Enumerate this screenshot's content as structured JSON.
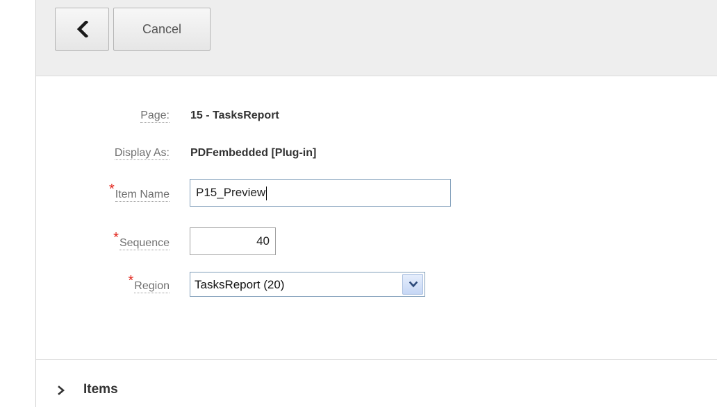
{
  "toolbar": {
    "back_icon": "chevron-left-icon",
    "cancel_label": "Cancel"
  },
  "form": {
    "page": {
      "label": "Page:",
      "value": "15 - TasksReport"
    },
    "display_as": {
      "label": "Display As:",
      "value": "PDFembedded [Plug-in]"
    },
    "item_name": {
      "label": "Item Name",
      "required_marker": "*",
      "value": "P15_Preview"
    },
    "sequence": {
      "label": "Sequence",
      "required_marker": "*",
      "value": "40"
    },
    "region": {
      "label": "Region",
      "required_marker": "*",
      "selected": "TasksReport (20)",
      "dropdown_icon": "chevron-down-icon"
    }
  },
  "items_section": {
    "label": "Items",
    "expand_icon": "chevron-right-icon"
  },
  "colors": {
    "required": "#e2231a",
    "toolbar_bg": "#eeeeee",
    "input_border": "#7f9db9"
  }
}
